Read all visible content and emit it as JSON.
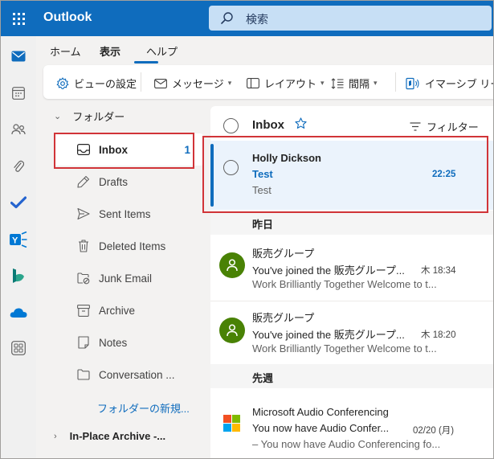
{
  "app": {
    "name": "Outlook"
  },
  "search": {
    "placeholder": "検索"
  },
  "tabs": [
    {
      "label": "ホーム"
    },
    {
      "label": "表示",
      "active": true
    },
    {
      "label": "ヘルプ"
    }
  ],
  "ribbon": {
    "view_settings": "ビューの設定",
    "messages": "メッセージ",
    "layout": "レイアウト",
    "spacing": "間隔",
    "immersive_reader": "イマーシブ リーダー"
  },
  "folders": {
    "header": "フォルダー",
    "items": [
      {
        "label": "Inbox",
        "count": "1",
        "icon": "inbox-icon",
        "selected": true
      },
      {
        "label": "Drafts",
        "icon": "pencil-icon"
      },
      {
        "label": "Sent Items",
        "icon": "send-icon"
      },
      {
        "label": "Deleted Items",
        "icon": "trash-icon"
      },
      {
        "label": "Junk Email",
        "icon": "junk-icon"
      },
      {
        "label": "Archive",
        "icon": "archive-icon"
      },
      {
        "label": "Notes",
        "icon": "note-icon"
      },
      {
        "label": "Conversation ...",
        "icon": "folder-icon"
      }
    ],
    "new_folder": "フォルダーの新規...",
    "archive_header": "In-Place Archive -..."
  },
  "list": {
    "title": "Inbox",
    "filter": "フィルター",
    "selected_message": {
      "sender": "Holly Dickson",
      "subject": "Test",
      "time": "22:25",
      "preview": "Test"
    },
    "groups": [
      {
        "label": "昨日",
        "messages": [
          {
            "sender": "販売グループ",
            "subject": "You've joined the 販売グループ...",
            "time": "木 18:34",
            "preview": "Work Brilliantly Together Welcome to t..."
          },
          {
            "sender": "販売グループ",
            "subject": "You've joined the 販売グループ...",
            "time": "木 18:20",
            "preview": "Work Brilliantly Together Welcome to t..."
          }
        ]
      },
      {
        "label": "先週",
        "messages": [
          {
            "sender": "Microsoft Audio Conferencing",
            "subject": "You now have Audio Confer...",
            "time": "02/20 (月)",
            "preview": "– You now have Audio Conferencing fo..."
          }
        ]
      }
    ]
  },
  "colors": {
    "brand": "#0f6cbd",
    "highlight": "#d13438",
    "avatar": "#498205"
  }
}
